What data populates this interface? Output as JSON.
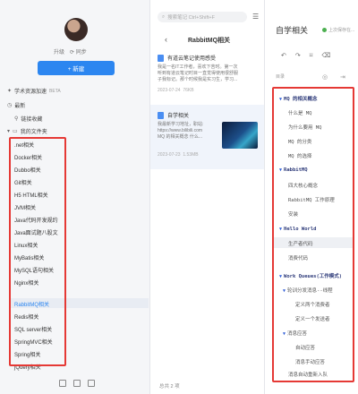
{
  "sidebar": {
    "upgrade_label": "升级",
    "sync_label": "同步",
    "new_button": "+ 新建",
    "items": [
      {
        "icon": "bookmark-icon",
        "label": "学术资源加速",
        "badge": "BETA"
      },
      {
        "icon": "clock-icon",
        "label": "最新"
      },
      {
        "icon": "link-icon",
        "label": "链接收藏"
      },
      {
        "icon": "folder-icon",
        "label": "我的文件夹"
      }
    ],
    "folders": [
      ".net相关",
      "Docker相关",
      "Dubbo相关",
      "Git相关",
      "H5 HTML相关",
      "JVM相关",
      "Java代码开发规约",
      "Java面试题八股文",
      "Linux相关",
      "MyBatis相关",
      "MySQL语句相关",
      "Nginx相关",
      "RabbitMQ相关",
      "Redis相关",
      "SQL server相关",
      "SpringMVC相关",
      "Spring相关",
      "jQuery相关"
    ],
    "active_folder": "RabbitMQ相关"
  },
  "list": {
    "search_placeholder": "搜索笔记 Ctrl+Shift+F",
    "title": "RabbitMQ相关",
    "notes": [
      {
        "title": "有道云笔记使用感受",
        "body": [
          "我是一名IT工作者，喜欢下苦时。第一次",
          "听到有道云笔记时目一直觉得使用很舒服",
          "子我标记。那个时候我是实习生，学习..."
        ],
        "date": "2023-07-24",
        "size": "76KB"
      },
      {
        "title": "自学相关",
        "body": [
          "我最新学习地址，职站:",
          "https://www.bilibili.com",
          "MQ 的相关概念 什么..."
        ],
        "date": "2023-07-23",
        "size": "1.53MB"
      }
    ],
    "footer": "总共 2 项"
  },
  "editor": {
    "title": "自学相关",
    "saved": "上次保存在...",
    "toc_label": "目录",
    "outline": [
      {
        "text": "MQ 的相关概念",
        "level": 1
      },
      {
        "text": "什么是 MQ",
        "level": 2
      },
      {
        "text": "为什么要用 MQ",
        "level": 2
      },
      {
        "text": "MQ 的分类",
        "level": 2
      },
      {
        "text": "MQ 的选择",
        "level": 2
      },
      {
        "text": "RabbitMQ",
        "level": 1
      },
      {
        "text": "四大核心概念",
        "level": 2
      },
      {
        "text": "RabbitMQ 工作原理",
        "level": 2
      },
      {
        "text": "安装",
        "level": 2
      },
      {
        "text": "Hello World",
        "level": 1
      },
      {
        "text": "生产者代码",
        "level": 2
      },
      {
        "text": "消费代码",
        "level": 2
      },
      {
        "text": "Work Queues(工作模式)",
        "level": 1
      },
      {
        "text": "轮训分发消息--线程",
        "level": 2
      },
      {
        "text": "定义两个消费者",
        "level": 3
      },
      {
        "text": "定义一个发送者",
        "level": 3
      },
      {
        "text": "消息应答",
        "level": 2
      },
      {
        "text": "自动应答",
        "level": 3
      },
      {
        "text": "消息手动应答",
        "level": 3
      },
      {
        "text": "消息自动重新入队",
        "level": 3
      }
    ],
    "selected_outline": "生产者代码"
  },
  "colors": {
    "accent": "#2c86f0",
    "highlight_border": "#e53935",
    "outline_heading": "#2e3b7a"
  }
}
